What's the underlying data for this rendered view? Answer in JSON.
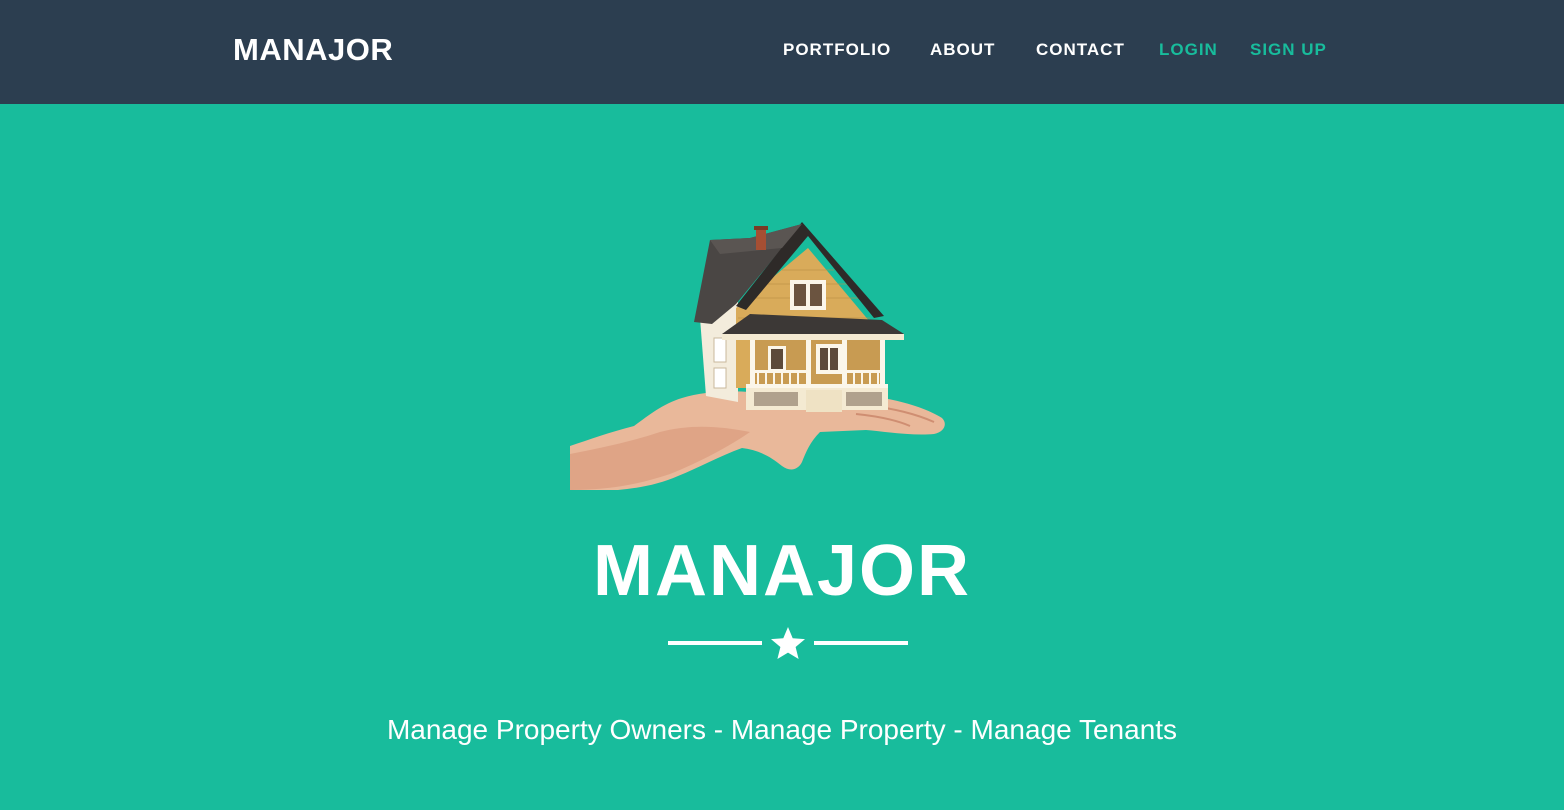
{
  "navbar": {
    "brand": "MANAJOR",
    "links": [
      {
        "label": "PORTFOLIO"
      },
      {
        "label": "ABOUT"
      },
      {
        "label": "CONTACT"
      },
      {
        "label": "LOGIN"
      },
      {
        "label": "SIGN UP"
      }
    ]
  },
  "hero": {
    "image_name": "house-in-hand-image",
    "title": "MANAJOR",
    "divider_icon": "star-icon",
    "tagline": "Manage Property Owners - Manage Property - Manage Tenants"
  },
  "colors": {
    "navbar_bg": "#2c3e50",
    "hero_bg": "#18bc9c",
    "accent": "#18bc9c",
    "text": "#ffffff"
  }
}
